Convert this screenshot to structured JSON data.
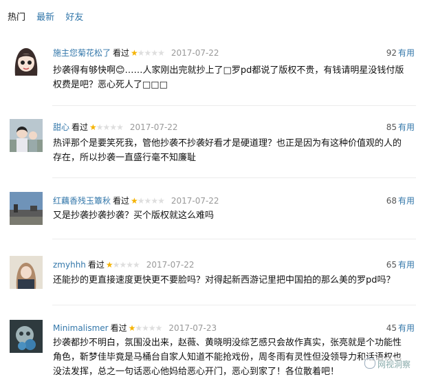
{
  "tabs": [
    {
      "label": "热门",
      "active": true
    },
    {
      "label": "最新",
      "active": false
    },
    {
      "label": "好友",
      "active": false
    }
  ],
  "comments": [
    {
      "user": "施主您菊花松了",
      "watched": "看过",
      "rating": 1,
      "max_rating": 5,
      "date": "2017-07-22",
      "votes": "92",
      "votes_label": "有用",
      "text": "抄袭得有够快啊😊……人家刚出完就抄上了□罗pd都说了版权不贵，有钱请明星没钱付版权费是吧？恶心死人了□□□"
    },
    {
      "user": "甜心",
      "watched": "看过",
      "rating": 1,
      "max_rating": 5,
      "date": "2017-07-22",
      "votes": "85",
      "votes_label": "有用",
      "text": "热评那个是要笑死我，管他抄袭不抄袭好看才是硬道理？也正是因为有这种价值观的人的存在，所以抄袭一直盛行毫不知廉耻"
    },
    {
      "user": "红藕香残玉簟秋",
      "watched": "看过",
      "rating": 1,
      "max_rating": 5,
      "date": "2017-07-22",
      "votes": "68",
      "votes_label": "有用",
      "text": "又是抄袭抄袭抄袭？买个版权就这么难吗"
    },
    {
      "user": "zmyhhh",
      "watched": "看过",
      "rating": 1,
      "max_rating": 5,
      "date": "2017-07-22",
      "votes": "65",
      "votes_label": "有用",
      "text": "还能抄的更直接速度更快更不要脸吗？对得起新西游记里把中国拍的那么美的罗pd吗？"
    },
    {
      "user": "Minimalismer",
      "watched": "看过",
      "rating": 1,
      "max_rating": 5,
      "date": "2017-07-23",
      "votes": "45",
      "votes_label": "有用",
      "text": "抄袭都抄不明白，氛围没出来，赵薇、黄晓明没综艺感只会故作真实，张亮就是个功能性角色，靳梦佳毕竟是马桶台自家人知道不能抢戏份，周冬雨有灵性但没领导力和话语权也没法发挥，总之一句话恶心他妈给恶心开门，恶心到家了！各位散着吧！"
    }
  ],
  "watermark": "网视洞察",
  "colors": {
    "link": "#3377aa",
    "star": "#f5b300",
    "date": "#999999"
  }
}
